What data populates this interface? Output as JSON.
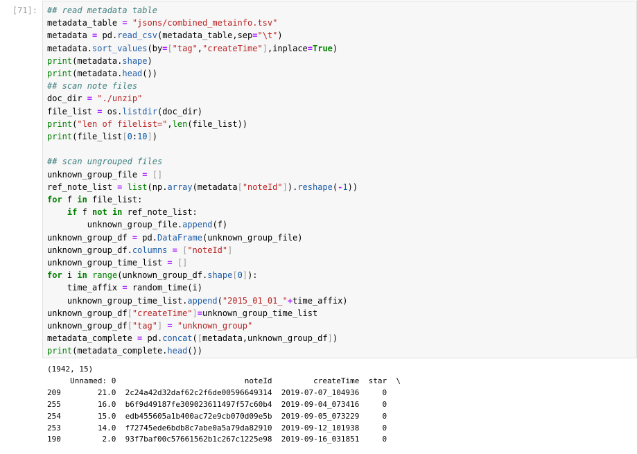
{
  "cell": {
    "prompt": "[71]:",
    "code": [
      [
        [
          "cm",
          "## read metadata table"
        ]
      ],
      [
        [
          "",
          "metadata_table "
        ],
        [
          "o",
          "="
        ],
        [
          "",
          ""
        ],
        [
          "s",
          " \"jsons/combined_metainfo.tsv\""
        ]
      ],
      [
        [
          "",
          "metadata "
        ],
        [
          "o",
          "="
        ],
        [
          "",
          " pd."
        ],
        [
          "mt",
          "read_csv"
        ],
        [
          "",
          "(metadata_table,sep"
        ],
        [
          "o",
          "="
        ],
        [
          "s",
          "\"\\t\""
        ],
        [
          "",
          ")"
        ]
      ],
      [
        [
          "",
          "metadata."
        ],
        [
          "mt",
          "sort_values"
        ],
        [
          "",
          "(by"
        ],
        [
          "o",
          "="
        ],
        [
          "br",
          "["
        ],
        [
          "s",
          "\"tag\""
        ],
        [
          "",
          ","
        ],
        [
          "s",
          "\"createTime\""
        ],
        [
          "br",
          "]"
        ],
        [
          "",
          ",inplace"
        ],
        [
          "o",
          "="
        ],
        [
          "k",
          "True"
        ],
        [
          "",
          ")"
        ]
      ],
      [
        [
          "b",
          "print"
        ],
        [
          "",
          "(metadata."
        ],
        [
          "mt",
          "shape"
        ],
        [
          "",
          ")"
        ]
      ],
      [
        [
          "b",
          "print"
        ],
        [
          "",
          "(metadata."
        ],
        [
          "mt",
          "head"
        ],
        [
          "",
          "())"
        ]
      ],
      [
        [
          "cm",
          "## scan note files"
        ]
      ],
      [
        [
          "",
          "doc_dir "
        ],
        [
          "o",
          "="
        ],
        [
          "s",
          " \"./unzip\""
        ]
      ],
      [
        [
          "",
          "file_list "
        ],
        [
          "o",
          "="
        ],
        [
          "",
          " os."
        ],
        [
          "mt",
          "listdir"
        ],
        [
          "",
          "(doc_dir)"
        ]
      ],
      [
        [
          "b",
          "print"
        ],
        [
          "",
          "("
        ],
        [
          "s",
          "\"len of filelist=\""
        ],
        [
          "",
          ","
        ],
        [
          "b",
          "len"
        ],
        [
          "",
          "(file_list))"
        ]
      ],
      [
        [
          "b",
          "print"
        ],
        [
          "",
          "(file_list"
        ],
        [
          "br",
          "["
        ],
        [
          "m",
          "0"
        ],
        [
          "",
          "："
        ],
        [
          "m",
          "10"
        ],
        [
          "br",
          "]"
        ],
        [
          "",
          ")"
        ]
      ],
      [
        [
          "",
          ""
        ]
      ],
      [
        [
          "cm",
          "## scan ungrouped files"
        ]
      ],
      [
        [
          "",
          "unknown_group_file "
        ],
        [
          "o",
          "="
        ],
        [
          "br",
          " []"
        ]
      ],
      [
        [
          "",
          "ref_note_list "
        ],
        [
          "o",
          "="
        ],
        [
          "",
          " "
        ],
        [
          "b",
          "list"
        ],
        [
          "",
          "(np."
        ],
        [
          "mt",
          "array"
        ],
        [
          "",
          "(metadata"
        ],
        [
          "br",
          "["
        ],
        [
          "s",
          "\"noteId\""
        ],
        [
          "br",
          "]"
        ],
        [
          "",
          ")."
        ],
        [
          "mt",
          "reshape"
        ],
        [
          "",
          "("
        ],
        [
          "o",
          "-"
        ],
        [
          "m",
          "1"
        ],
        [
          "",
          "))"
        ]
      ],
      [
        [
          "k",
          "for"
        ],
        [
          "",
          " f "
        ],
        [
          "k",
          "in"
        ],
        [
          "",
          " file_list:"
        ]
      ],
      [
        [
          "",
          "    "
        ],
        [
          "k",
          "if"
        ],
        [
          "",
          " f "
        ],
        [
          "k",
          "not in"
        ],
        [
          "",
          " ref_note_list:"
        ]
      ],
      [
        [
          "",
          "        unknown_group_file."
        ],
        [
          "mt",
          "append"
        ],
        [
          "",
          "(f)"
        ]
      ],
      [
        [
          "",
          "unknown_group_df "
        ],
        [
          "o",
          "="
        ],
        [
          "",
          " pd."
        ],
        [
          "mt",
          "DataFrame"
        ],
        [
          "",
          "(unknown_group_file)"
        ]
      ],
      [
        [
          "",
          "unknown_group_df."
        ],
        [
          "mt",
          "columns"
        ],
        [
          "",
          " "
        ],
        [
          "o",
          "="
        ],
        [
          "br",
          " ["
        ],
        [
          "s",
          "\"noteId\""
        ],
        [
          "br",
          "]"
        ]
      ],
      [
        [
          "",
          "unknown_group_time_list "
        ],
        [
          "o",
          "="
        ],
        [
          "br",
          " []"
        ]
      ],
      [
        [
          "k",
          "for"
        ],
        [
          "",
          " i "
        ],
        [
          "k",
          "in"
        ],
        [
          "",
          " "
        ],
        [
          "b",
          "range"
        ],
        [
          "",
          "(unknown_group_df."
        ],
        [
          "mt",
          "shape"
        ],
        [
          "br",
          "["
        ],
        [
          "m",
          "0"
        ],
        [
          "br",
          "]"
        ],
        [
          "",
          "):"
        ]
      ],
      [
        [
          "",
          "    time_affix "
        ],
        [
          "o",
          "="
        ],
        [
          "",
          " random_time(i)"
        ]
      ],
      [
        [
          "",
          "    unknown_group_time_list."
        ],
        [
          "mt",
          "append"
        ],
        [
          "",
          "("
        ],
        [
          "s",
          "\"2015_01_01_\""
        ],
        [
          "o",
          "+"
        ],
        [
          "",
          "time_affix)"
        ]
      ],
      [
        [
          "",
          "unknown_group_df"
        ],
        [
          "br",
          "["
        ],
        [
          "s",
          "\"createTime\""
        ],
        [
          "br",
          "]"
        ],
        [
          "o",
          "="
        ],
        [
          "",
          "unknown_group_time_list"
        ]
      ],
      [
        [
          "",
          "unknown_group_df"
        ],
        [
          "br",
          "["
        ],
        [
          "s",
          "\"tag\""
        ],
        [
          "br",
          "]"
        ],
        [
          "",
          " "
        ],
        [
          "o",
          "="
        ],
        [
          "s",
          " \"unknown_group\""
        ]
      ],
      [
        [
          "",
          "metadata_complete "
        ],
        [
          "o",
          "="
        ],
        [
          "",
          " pd."
        ],
        [
          "mt",
          "concat"
        ],
        [
          "",
          "("
        ],
        [
          "br",
          "["
        ],
        [
          "",
          "metadata,unknown_group_df"
        ],
        [
          "br",
          "]"
        ],
        [
          "",
          ")"
        ]
      ],
      [
        [
          "b",
          "print"
        ],
        [
          "",
          "(metadata_complete."
        ],
        [
          "mt",
          "head"
        ],
        [
          "",
          "())"
        ]
      ]
    ]
  },
  "output": {
    "lines": [
      "(1942, 15)",
      "     Unnamed: 0                            noteId         createTime  star  \\",
      "209        21.0  2c24a42d32daf62c2f6de00596649314  2019-07-07_104936     0   ",
      "255        16.0  b6f9d49187fe309023611497f57c60b4  2019-09-04_073416     0   ",
      "254        15.0  edb455605a1b400ac72e9cb070d09e5b  2019-09-05_073229     0   ",
      "253        14.0  f72745ede6bdb8c7abe0a5a79da82910  2019-09-12_101938     0   ",
      "190         2.0  93f7baf00c57661562b1c267c1225e98  2019-09-16_031851     0   "
    ]
  }
}
